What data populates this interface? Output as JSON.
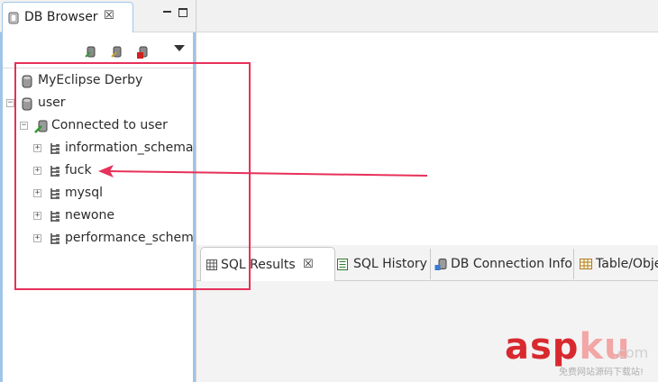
{
  "left_view": {
    "tab_title": "DB Browser",
    "tab_close": "☒",
    "toolbar": {
      "icons": [
        "new-connection-icon",
        "edit-connection-icon",
        "delete-connection-icon"
      ],
      "view_menu": "view-menu-icon"
    },
    "tree": [
      {
        "label": "MyEclipse Derby",
        "icon": "database-icon",
        "expander": ""
      },
      {
        "label": "user",
        "icon": "database-icon",
        "expander": "−"
      },
      {
        "label": "Connected to user",
        "icon": "connection-icon",
        "expander": "−"
      },
      {
        "label": "information_schema",
        "icon": "schema-icon",
        "expander": "+"
      },
      {
        "label": "fuck",
        "icon": "schema-icon",
        "expander": "+"
      },
      {
        "label": "mysql",
        "icon": "schema-icon",
        "expander": "+"
      },
      {
        "label": "newone",
        "icon": "schema-icon",
        "expander": "+"
      },
      {
        "label": "performance_schema",
        "icon": "schema-icon",
        "expander": "+"
      }
    ]
  },
  "bottom_panel": {
    "tabs": [
      {
        "label": "SQL Results",
        "icon": "grid-icon",
        "active": true,
        "close": "☒"
      },
      {
        "label": "SQL History",
        "icon": "history-icon",
        "active": false
      },
      {
        "label": "DB Connection Info",
        "icon": "db-info-icon",
        "active": false
      },
      {
        "label": "Table/Obje",
        "icon": "table-icon",
        "active": false
      }
    ]
  },
  "annotation": {
    "color": "#e8305a"
  },
  "watermark": {
    "asp": "asp",
    "ku": "ku",
    "com": ".com",
    "sub": "免费网站源码下载站!"
  },
  "colors": {
    "accent": "#9fc4e8",
    "annotation": "#e8305a",
    "brand_red": "#d8292f"
  }
}
